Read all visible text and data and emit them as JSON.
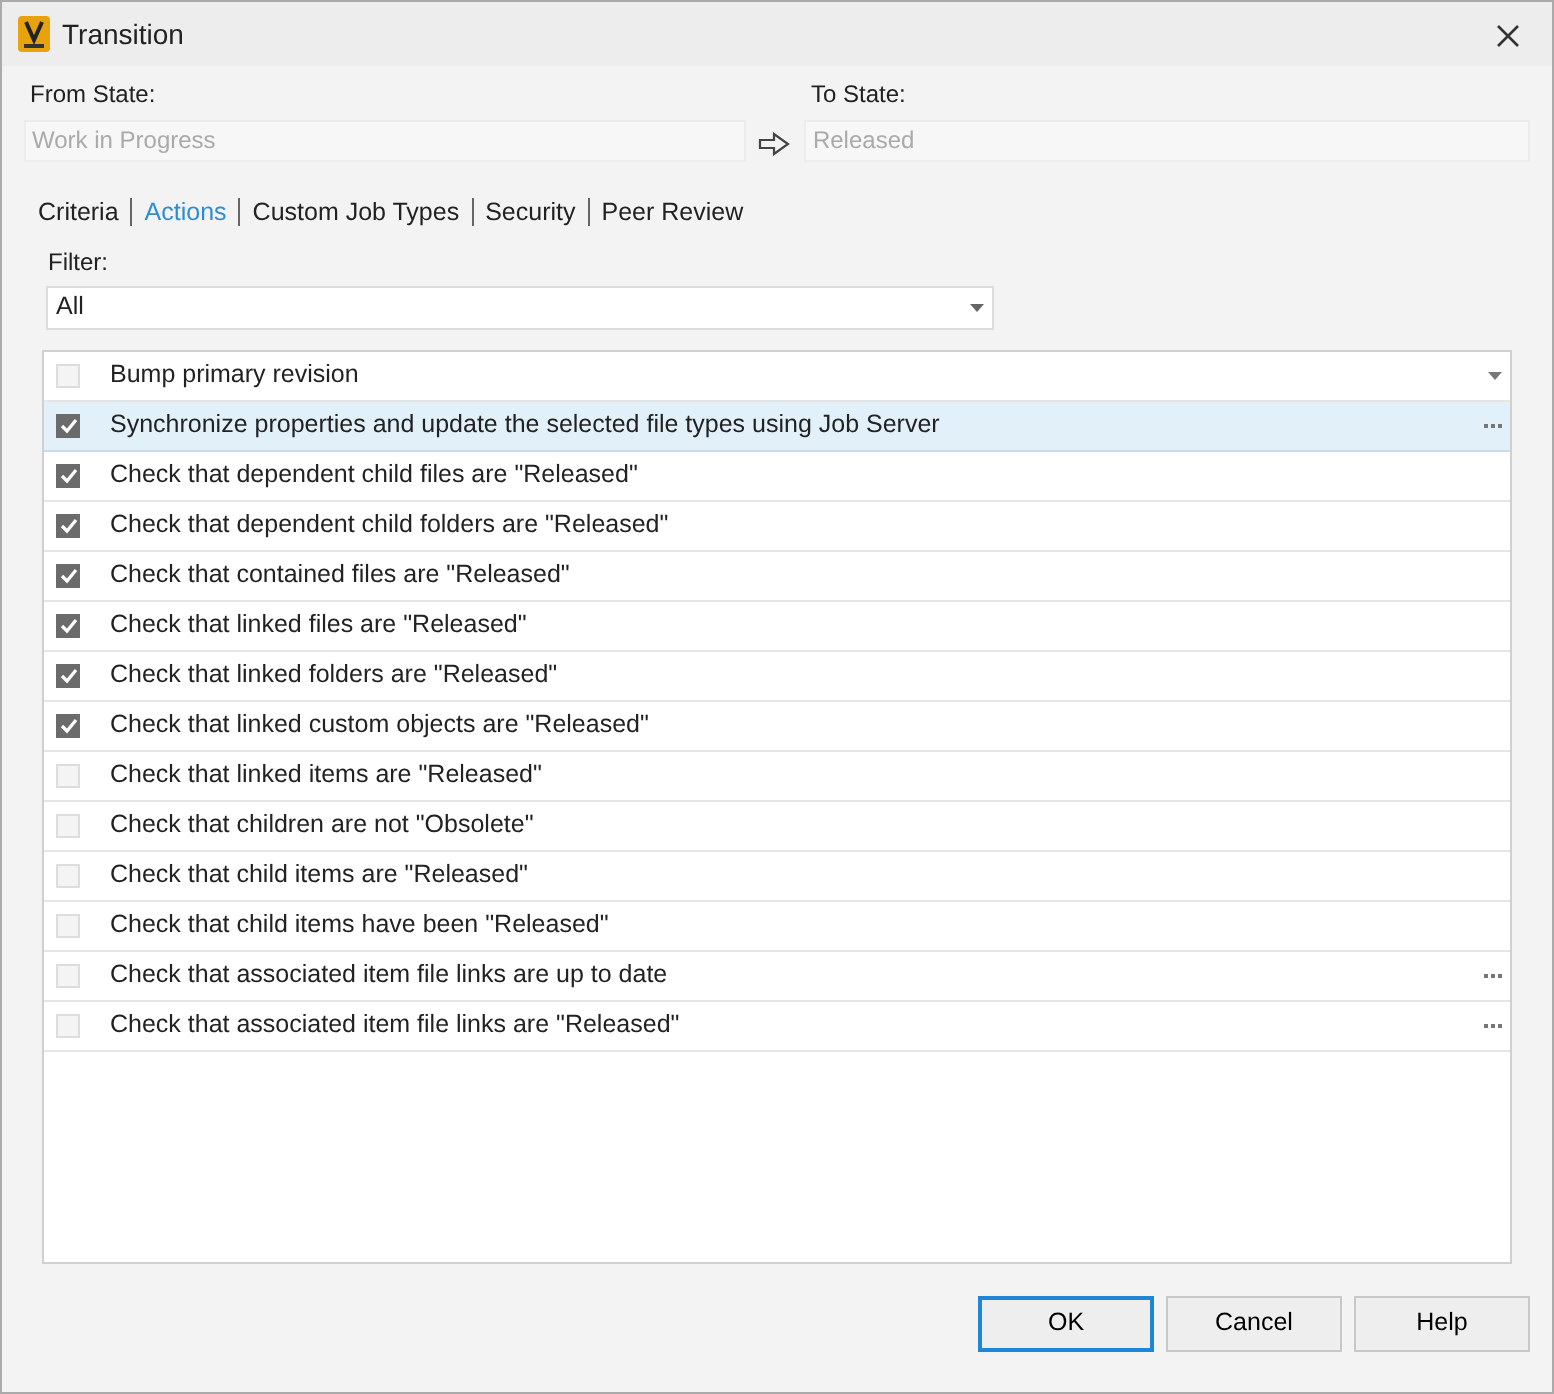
{
  "window": {
    "title": "Transition"
  },
  "from_state": {
    "label": "From State:",
    "value": "Work in Progress"
  },
  "to_state": {
    "label": "To State:",
    "value": "Released"
  },
  "tabs": [
    {
      "label": "Criteria",
      "selected": false
    },
    {
      "label": "Actions",
      "selected": true
    },
    {
      "label": "Custom Job Types",
      "selected": false
    },
    {
      "label": "Security",
      "selected": false
    },
    {
      "label": "Peer Review",
      "selected": false
    }
  ],
  "filter": {
    "label": "Filter:",
    "value": "All"
  },
  "actions": [
    {
      "label": "Bump primary revision",
      "checked": false,
      "selected": false,
      "kind": "dropdown"
    },
    {
      "label": "Synchronize properties and update the selected file types using Job Server",
      "checked": true,
      "selected": true,
      "kind": "ellipsis"
    },
    {
      "label": "Check that dependent child files are \"Released\"",
      "checked": true,
      "selected": false,
      "kind": "plain"
    },
    {
      "label": "Check that dependent child folders are \"Released\"",
      "checked": true,
      "selected": false,
      "kind": "plain"
    },
    {
      "label": "Check that contained files are \"Released\"",
      "checked": true,
      "selected": false,
      "kind": "plain"
    },
    {
      "label": "Check that linked files are \"Released\"",
      "checked": true,
      "selected": false,
      "kind": "plain"
    },
    {
      "label": "Check that linked folders are \"Released\"",
      "checked": true,
      "selected": false,
      "kind": "plain"
    },
    {
      "label": "Check that linked custom objects are \"Released\"",
      "checked": true,
      "selected": false,
      "kind": "plain"
    },
    {
      "label": "Check that linked items are \"Released\"",
      "checked": false,
      "selected": false,
      "kind": "plain"
    },
    {
      "label": "Check that children are not \"Obsolete\"",
      "checked": false,
      "selected": false,
      "kind": "plain"
    },
    {
      "label": "Check that child items are \"Released\"",
      "checked": false,
      "selected": false,
      "kind": "plain"
    },
    {
      "label": "Check that child items have been \"Released\"",
      "checked": false,
      "selected": false,
      "kind": "plain"
    },
    {
      "label": "Check that associated item file links are up to date",
      "checked": false,
      "selected": false,
      "kind": "ellipsis"
    },
    {
      "label": "Check that associated item file links are \"Released\"",
      "checked": false,
      "selected": false,
      "kind": "ellipsis"
    }
  ],
  "buttons": [
    {
      "label": "OK",
      "default": true
    },
    {
      "label": "Cancel",
      "default": false
    },
    {
      "label": "Help",
      "default": false
    }
  ]
}
